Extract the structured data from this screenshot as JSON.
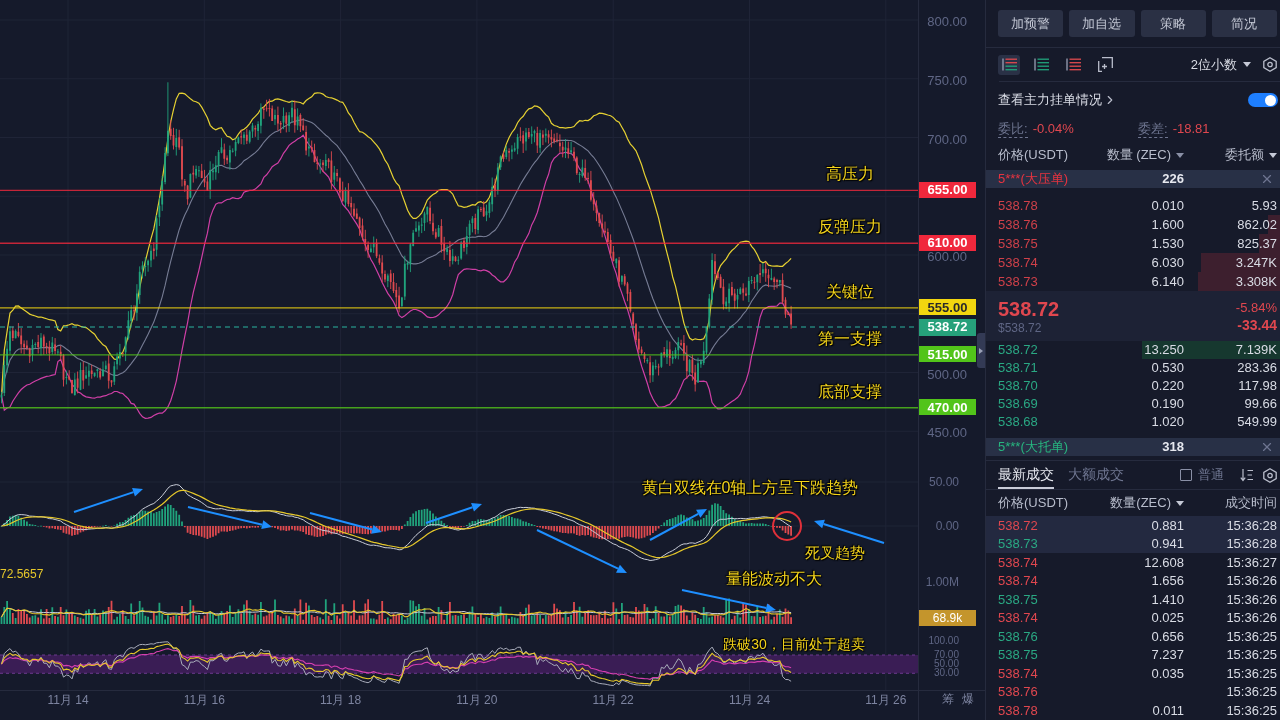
{
  "chart": {
    "price_axis": [
      "800.00",
      "750.00",
      "700.00",
      "600.00",
      "500.00",
      "450.00"
    ],
    "levels": [
      {
        "label": "高压力",
        "price": "655.00",
        "color": "#f0283c"
      },
      {
        "label": "反弹压力",
        "price": "610.00",
        "color": "#f0283c"
      },
      {
        "label": "关键位",
        "price": "555.00",
        "color": "#f2d60f"
      },
      {
        "label": "第一支撑",
        "price": "515.00",
        "color": "#52c41a"
      },
      {
        "label": "底部支撑",
        "price": "470.00",
        "color": "#52c41a"
      }
    ],
    "current_price": "538.72",
    "macd_axis": [
      "50.00",
      "0.00"
    ],
    "volume_axis": [
      "1.00M"
    ],
    "volume_ma": "72.5657",
    "volume_tag": "68.9k",
    "rsi_axis": [
      "100.00",
      "70.00",
      "50.00",
      "30.00"
    ],
    "date_axis": [
      "11月 14",
      "11月 16",
      "11月 18",
      "11月 20",
      "11月 22",
      "11月 24",
      "11月 26"
    ],
    "pane_buttons": [
      "筹",
      "爆"
    ],
    "annotations": [
      "黄白双线在0轴上方呈下跌趋势",
      "死叉趋势",
      "量能波动不大",
      "跌破30，目前处于超卖"
    ]
  },
  "actions": [
    "加预警",
    "加自选",
    "策略",
    "简况"
  ],
  "order_book": {
    "view_modes": [
      {
        "kind": "both",
        "selected": true
      },
      {
        "kind": "bids",
        "selected": false
      },
      {
        "kind": "asks",
        "selected": false
      },
      {
        "kind": "custom",
        "selected": false
      }
    ],
    "precision": "2位小数",
    "main_orders": {
      "label": "查看主力挂单情况",
      "on": true
    },
    "ratio": {
      "label": "委比:",
      "value": "-0.04%"
    },
    "diff": {
      "label": "委差:",
      "value": "-18.81"
    },
    "columns": [
      "价格(USDT)",
      "数量 (ZEC)",
      "委托额"
    ],
    "ask_alert": {
      "label": "5***(大压单)",
      "value": "226"
    },
    "asks": [
      {
        "price": "538.78",
        "qty": "0.010",
        "amount": "5.93"
      },
      {
        "price": "538.76",
        "qty": "1.600",
        "amount": "862.02",
        "level": 0.04
      },
      {
        "price": "538.75",
        "qty": "1.530",
        "amount": "825.37",
        "level": 0.07
      },
      {
        "price": "538.74",
        "qty": "6.030",
        "amount": "3.247K",
        "level": 0.27
      },
      {
        "price": "538.73",
        "qty": "6.140",
        "amount": "3.308K",
        "level": 0.28
      }
    ],
    "last": {
      "price": "538.72",
      "usd": "$538.72",
      "change_pct": "-5.84%",
      "change": "-33.44",
      "falling": true
    },
    "bids": [
      {
        "price": "538.72",
        "qty": "13.250",
        "amount": "7.139K",
        "level": 0.47
      },
      {
        "price": "538.71",
        "qty": "0.530",
        "amount": "283.36"
      },
      {
        "price": "538.70",
        "qty": "0.220",
        "amount": "117.98"
      },
      {
        "price": "538.69",
        "qty": "0.190",
        "amount": "99.66"
      },
      {
        "price": "538.68",
        "qty": "1.020",
        "amount": "549.99"
      }
    ],
    "bid_alert": {
      "label": "5***(大托单)",
      "value": "318"
    }
  },
  "trades": {
    "tabs": [
      {
        "label": "最新成交",
        "selected": true
      },
      {
        "label": "大额成交",
        "selected": false
      }
    ],
    "filter": {
      "label": "普通",
      "checked": false
    },
    "columns": [
      "价格(USDT)",
      "数量(ZEC)",
      "成交时间"
    ],
    "rows": [
      {
        "kind": "sell",
        "price": "538.72",
        "qty": "0.881",
        "time": "15:36:28",
        "highlighted": true
      },
      {
        "kind": "buy",
        "price": "538.73",
        "qty": "0.941",
        "time": "15:36:28",
        "highlighted": true
      },
      {
        "kind": "sell",
        "price": "538.74",
        "qty": "12.608",
        "time": "15:36:27",
        "highlighted": false
      },
      {
        "kind": "sell",
        "price": "538.74",
        "qty": "1.656",
        "time": "15:36:26",
        "highlighted": false
      },
      {
        "kind": "buy",
        "price": "538.75",
        "qty": "1.410",
        "time": "15:36:26",
        "highlighted": false
      },
      {
        "kind": "sell",
        "price": "538.74",
        "qty": "0.025",
        "time": "15:36:26",
        "highlighted": false
      },
      {
        "kind": "buy",
        "price": "538.76",
        "qty": "0.656",
        "time": "15:36:25",
        "highlighted": false
      },
      {
        "kind": "buy",
        "price": "538.75",
        "qty": "7.237",
        "time": "15:36:25",
        "highlighted": false
      },
      {
        "kind": "sell",
        "price": "538.74",
        "qty": "0.035",
        "time": "15:36:25",
        "highlighted": false
      },
      {
        "kind": "sell",
        "price": "538.76",
        "time": "15:36:25",
        "highlighted": false
      },
      {
        "kind": "sell",
        "price": "538.78",
        "qty": "0.011",
        "time": "15:36:25",
        "highlighted": false
      }
    ]
  }
}
